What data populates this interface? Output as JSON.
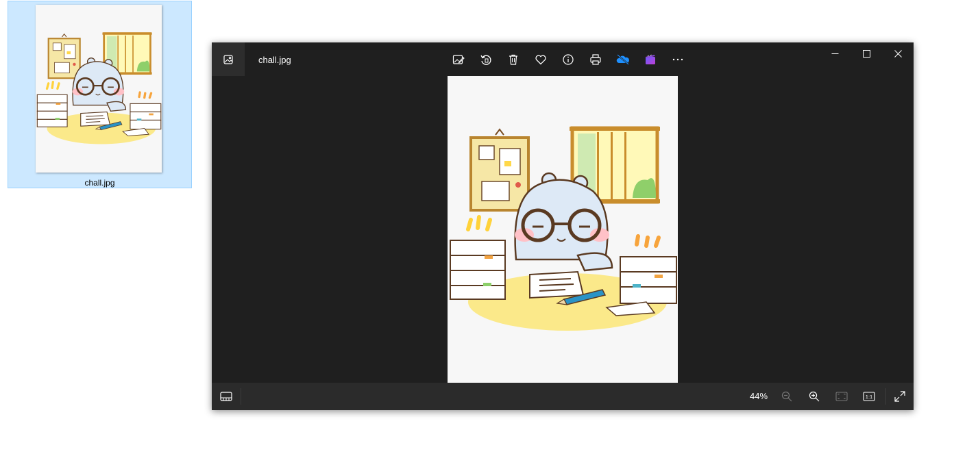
{
  "desktop": {
    "file_name": "chall.jpg",
    "selection_color": "#cce8ff"
  },
  "window": {
    "title": "chall.jpg",
    "app": "Photos",
    "toolbar_icons": [
      "edit-image-icon",
      "rotate-icon",
      "delete-icon",
      "favorite-heart-icon",
      "info-icon",
      "print-icon",
      "onedrive-icon",
      "clipchamp-icon",
      "more-options-icon"
    ],
    "window_controls": [
      "minimize-icon",
      "maximize-icon",
      "close-icon"
    ],
    "bottom_bar": {
      "zoom_level": "44%",
      "icons": [
        "filmstrip-icon",
        "zoom-out-icon",
        "zoom-in-icon",
        "fit-to-window-icon",
        "actual-size-icon",
        "fullscreen-icon"
      ],
      "actual_size_label": "1:1"
    },
    "colors": {
      "background": "#1f1f1f",
      "bar": "#2b2b2b",
      "onedrive": "#1e90ff",
      "clipchamp": "#8a4bd6"
    }
  },
  "image": {
    "subject": "bear with glasses at desk with paper stacks"
  }
}
